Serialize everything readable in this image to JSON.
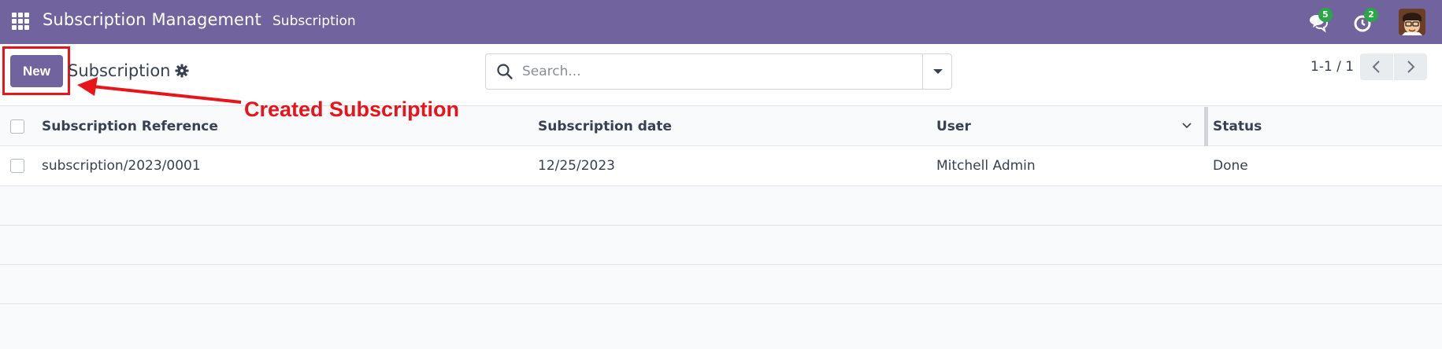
{
  "navbar": {
    "app_title": "Subscription Management",
    "menu_item": "Subscription",
    "messages_count": "5",
    "activities_count": "2",
    "bg_color": "#71639e",
    "badge_color": "#28a745"
  },
  "control_panel": {
    "new_button": "New",
    "breadcrumb": "Subscription",
    "search_placeholder": "Search...",
    "pager_text": "1-1 / 1"
  },
  "annotation": {
    "label": "Created Subscription",
    "color": "#e8141a"
  },
  "table": {
    "columns": [
      "Subscription Reference",
      "Subscription date",
      "User",
      "Status"
    ],
    "rows": [
      {
        "reference": "subscription/2023/0001",
        "date": "12/25/2023",
        "user": "Mitchell Admin",
        "status": "Done"
      }
    ]
  }
}
